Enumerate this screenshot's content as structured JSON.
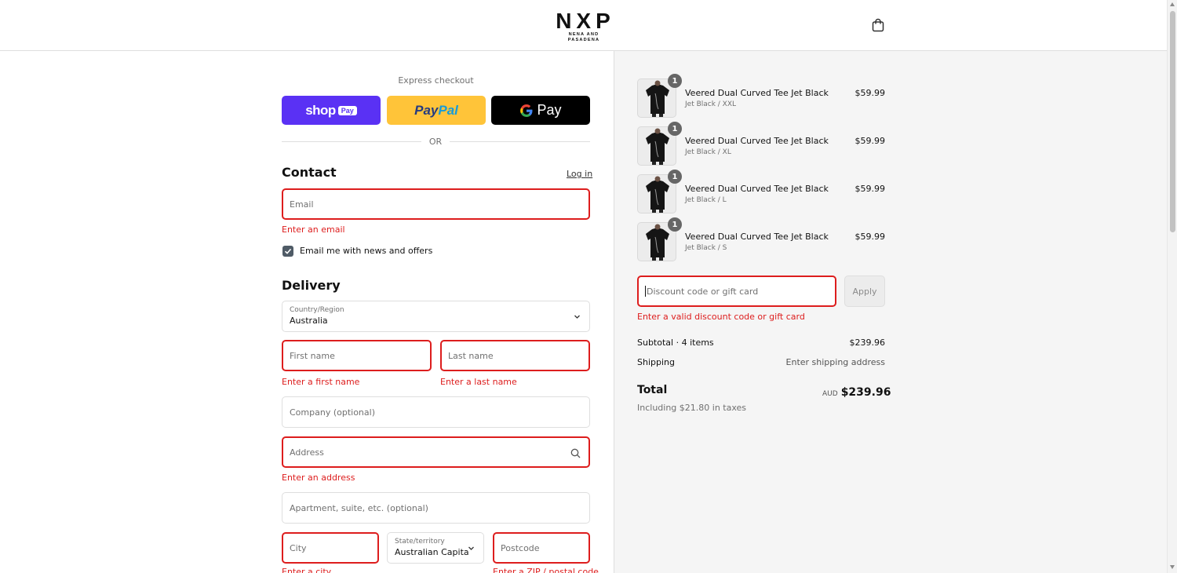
{
  "header": {
    "logo_main": "NXP",
    "logo_sub": "NENA AND PASADENA",
    "cart_icon": "shopping-bag-icon"
  },
  "express": {
    "label": "Express checkout",
    "shop_pay": {
      "word": "shop",
      "badge": "Pay",
      "color": "#5a31f4"
    },
    "paypal": {
      "pay": "Pay",
      "pal": "Pal",
      "color": "#ffc439"
    },
    "gpay": {
      "g": "G",
      "word": "Pay",
      "color": "#000000"
    },
    "or_text": "OR"
  },
  "contact": {
    "title": "Contact",
    "login": "Log in",
    "email_placeholder": "Email",
    "email_error": "Enter an email",
    "news_label": "Email me with news and offers",
    "news_checked": true
  },
  "delivery": {
    "title": "Delivery",
    "country_label": "Country/Region",
    "country_value": "Australia",
    "first_name_placeholder": "First name",
    "first_name_error": "Enter a first name",
    "last_name_placeholder": "Last name",
    "last_name_error": "Enter a last name",
    "company_placeholder": "Company (optional)",
    "address_placeholder": "Address",
    "address_error": "Enter an address",
    "apartment_placeholder": "Apartment, suite, etc. (optional)",
    "city_placeholder": "City",
    "city_error": "Enter a city",
    "state_label": "State/territory",
    "state_value": "Australian Capita...",
    "postcode_placeholder": "Postcode",
    "postcode_error": "Enter a ZIP / postal code"
  },
  "cart": {
    "items": [
      {
        "name": "Veered Dual Curved Tee Jet Black",
        "variant": "Jet Black / XXL",
        "price": "$59.99",
        "qty": "1"
      },
      {
        "name": "Veered Dual Curved Tee Jet Black",
        "variant": "Jet Black / XL",
        "price": "$59.99",
        "qty": "1"
      },
      {
        "name": "Veered Dual Curved Tee Jet Black",
        "variant": "Jet Black / L",
        "price": "$59.99",
        "qty": "1"
      },
      {
        "name": "Veered Dual Curved Tee Jet Black",
        "variant": "Jet Black / S",
        "price": "$59.99",
        "qty": "1"
      }
    ],
    "discount_placeholder": "Discount code or gift card",
    "discount_error": "Enter a valid discount code or gift card",
    "apply_label": "Apply"
  },
  "summary": {
    "subtotal_label": "Subtotal · 4 items",
    "subtotal_value": "$239.96",
    "shipping_label": "Shipping",
    "shipping_value": "Enter shipping address",
    "total_label": "Total",
    "total_currency": "AUD",
    "total_value": "$239.96",
    "taxes": "Including $21.80 in taxes"
  },
  "colors": {
    "error": "#dd1d1d",
    "panel_bg": "#f5f5f5",
    "border": "#dedede"
  }
}
